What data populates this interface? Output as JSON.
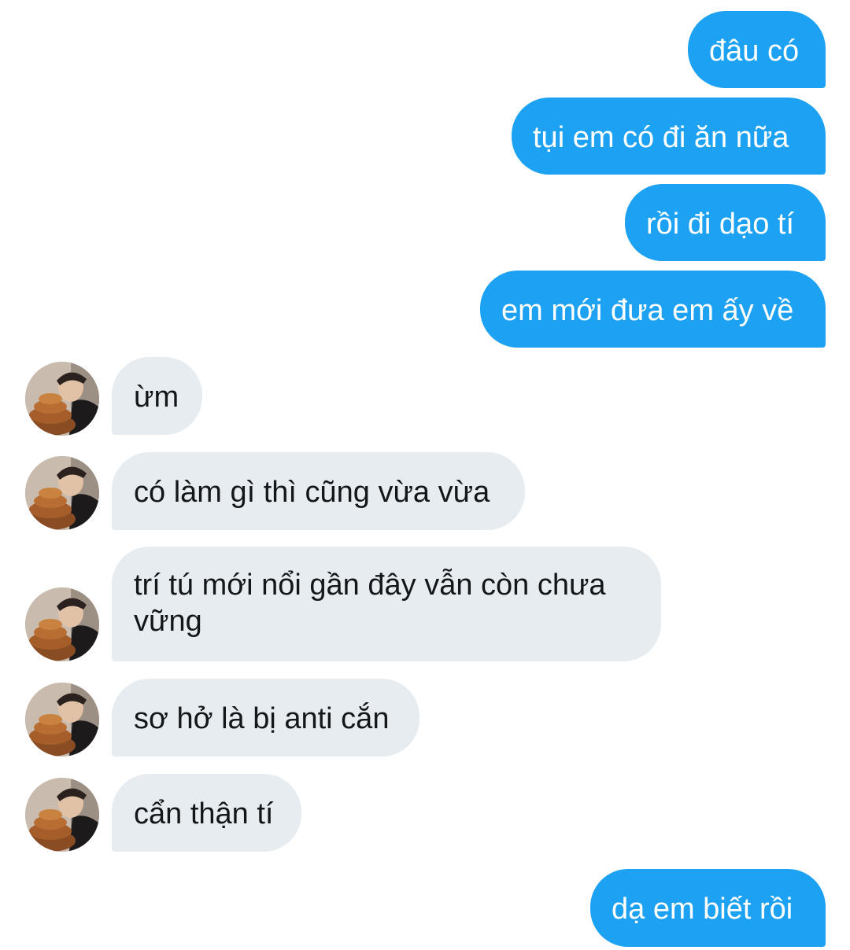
{
  "conversation": {
    "messages": [
      {
        "side": "out",
        "text": "đâu có"
      },
      {
        "side": "out",
        "text": "tụi em có đi ăn nữa"
      },
      {
        "side": "out",
        "text": "rồi đi dạo tí"
      },
      {
        "side": "out",
        "text": "em mới đưa em ấy về"
      },
      {
        "side": "in",
        "text": "ừm"
      },
      {
        "side": "in",
        "text": "có làm gì thì cũng vừa vừa"
      },
      {
        "side": "in",
        "text": "trí tú mới nổi gần đây vẫn còn chưa vững"
      },
      {
        "side": "in",
        "text": "sơ hở là bị anti cắn"
      },
      {
        "side": "in",
        "text": "cẩn thận tí"
      },
      {
        "side": "out",
        "text": "dạ em biết rồi"
      }
    ],
    "colors": {
      "outgoing_bubble": "#1da1f2",
      "incoming_bubble": "#e6ecf0",
      "outgoing_text": "#ffffff",
      "incoming_text": "#14171a"
    },
    "avatar_icon": "contact-avatar"
  }
}
